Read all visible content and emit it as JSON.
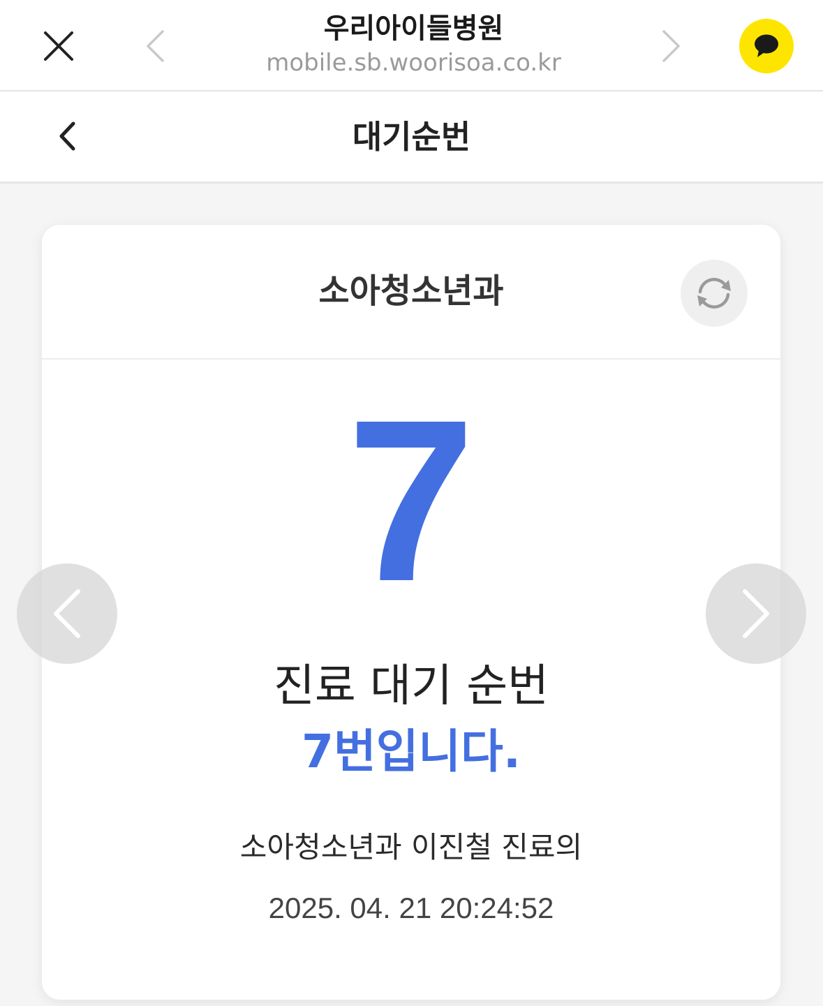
{
  "browser": {
    "site_name": "우리아이들병원",
    "site_url": "mobile.sb.woorisoa.co.kr",
    "close_icon": "close-icon",
    "back_icon": "chevron-left-icon",
    "forward_icon": "chevron-right-icon",
    "share_icon": "kakao-talk-icon",
    "share_color": "#FEE500"
  },
  "header": {
    "title": "대기순번",
    "back_icon": "chevron-left-icon"
  },
  "card": {
    "department": "소아청소년과",
    "refresh_icon": "refresh-icon",
    "number": "7",
    "number_color": "#446FE0",
    "label": "진료 대기 순번",
    "message": "7번입니다.",
    "doctor_line": "소아청소년과 이진철 진료의",
    "timestamp": "2025. 04. 21 20:24:52"
  },
  "carousel": {
    "prev_icon": "chevron-left-icon",
    "next_icon": "chevron-right-icon"
  }
}
